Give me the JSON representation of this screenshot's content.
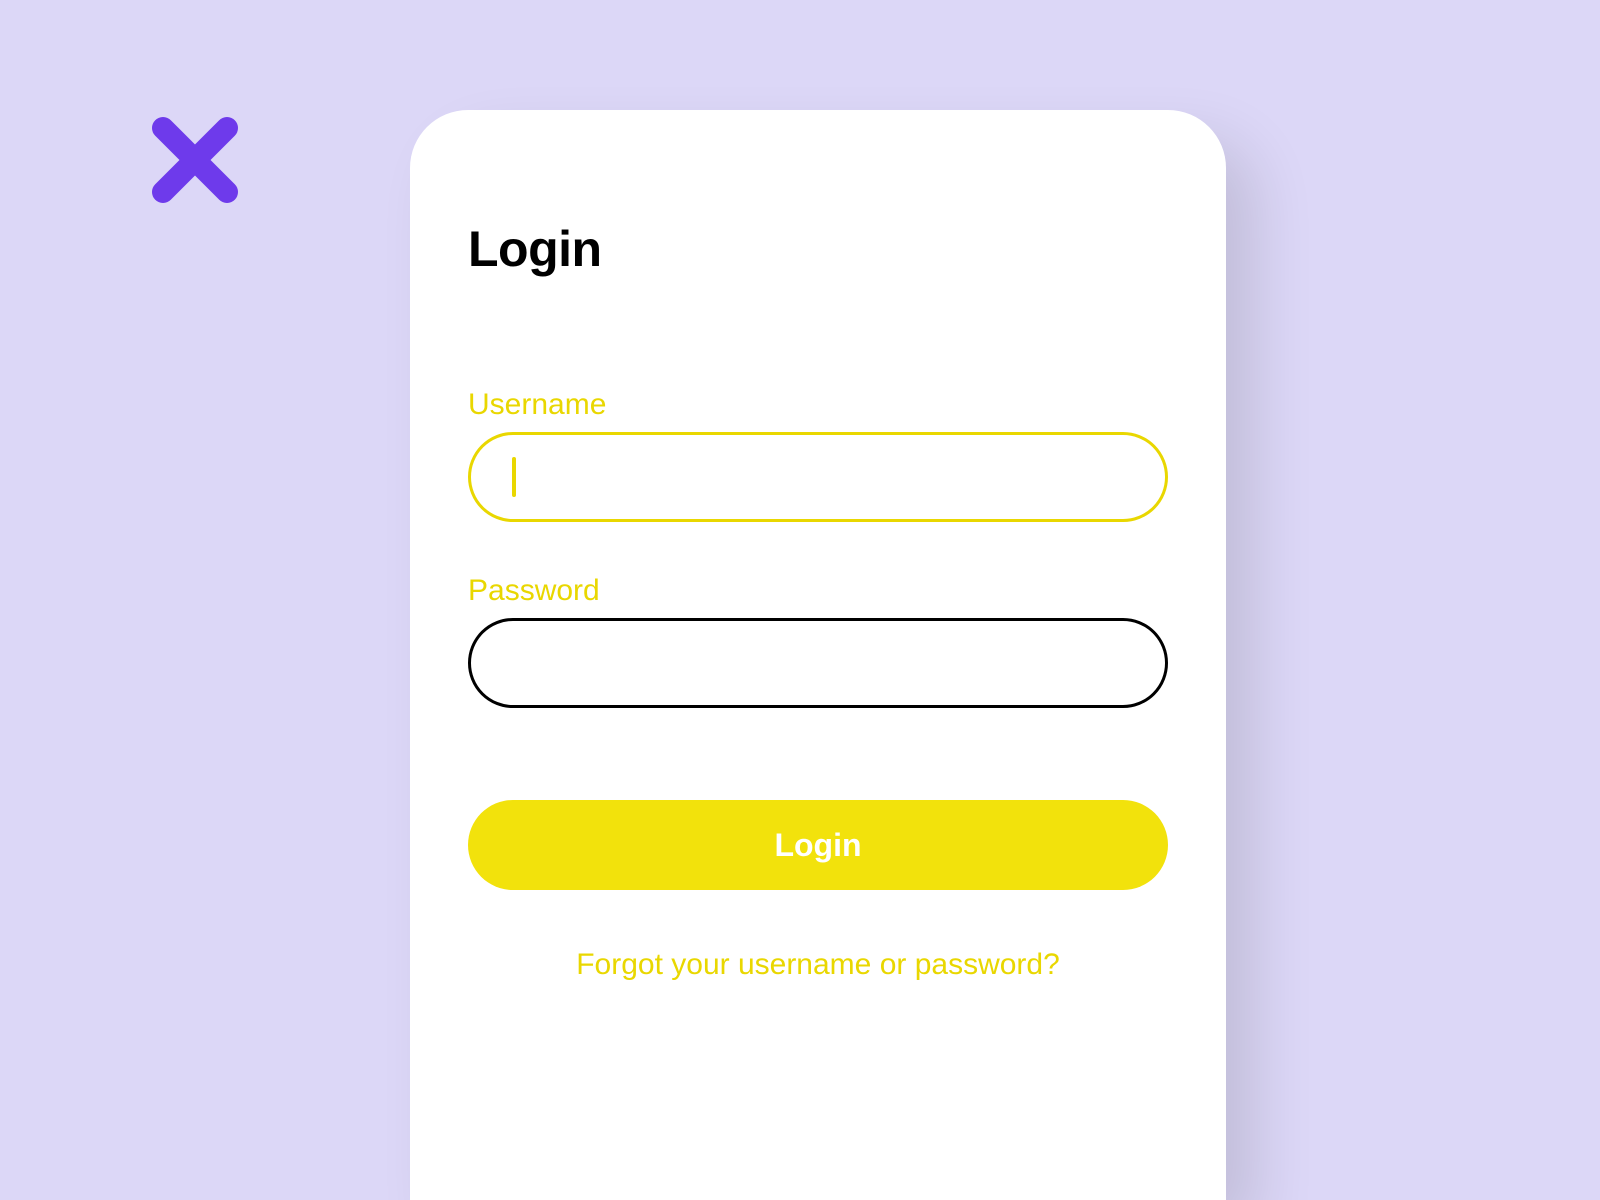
{
  "page": {
    "title": "Login"
  },
  "form": {
    "username": {
      "label": "Username",
      "value": ""
    },
    "password": {
      "label": "Password",
      "value": ""
    },
    "submit_label": "Login",
    "forgot_link_label": "Forgot your username or password?"
  },
  "colors": {
    "background": "#dcd7f7",
    "accent": "#f2e20c",
    "accent_text": "#e9d700",
    "close_icon": "#6e3aeb"
  }
}
